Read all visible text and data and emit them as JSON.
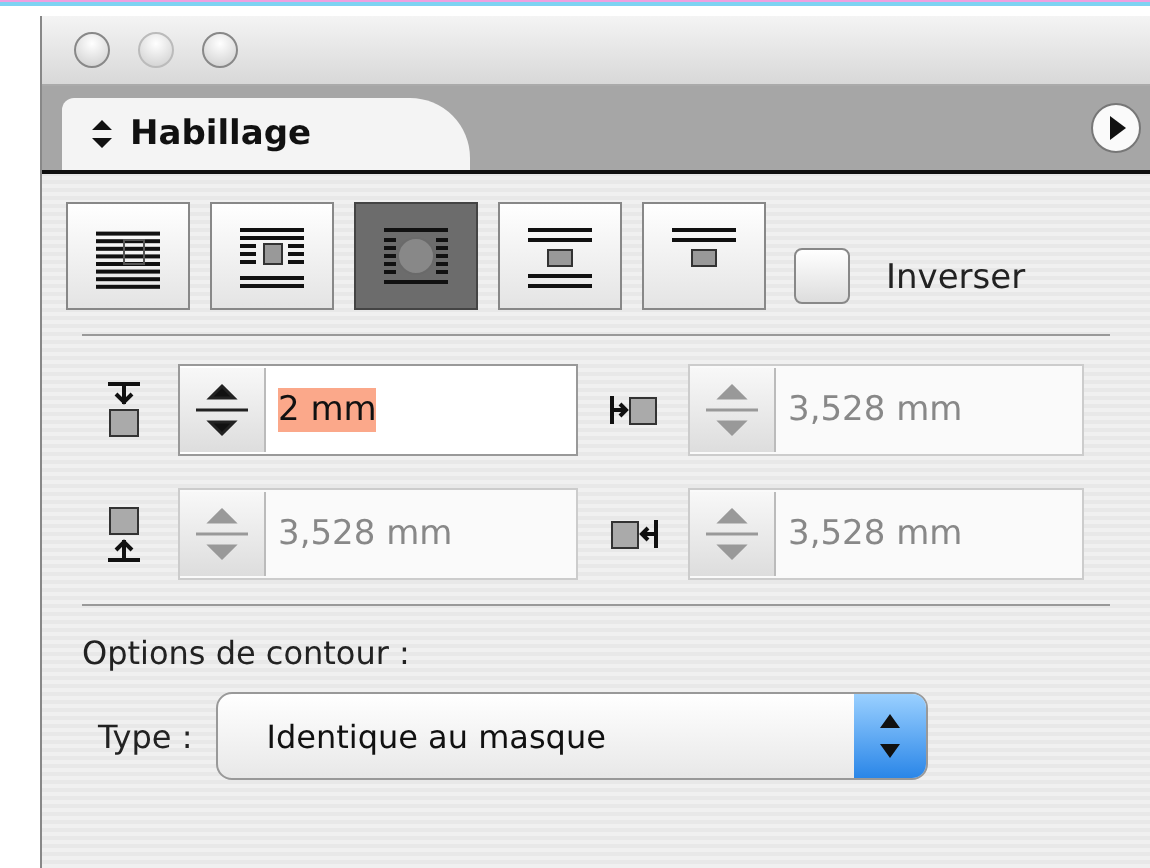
{
  "panel": {
    "tab": {
      "label": "Habillage",
      "selected": true
    }
  },
  "wrap_options": [
    {
      "kind": "none",
      "selected": false
    },
    {
      "kind": "bounding-box",
      "selected": false
    },
    {
      "kind": "object-shape",
      "selected": true
    },
    {
      "kind": "jump-object",
      "selected": false
    },
    {
      "kind": "jump-next-column",
      "selected": false
    }
  ],
  "invert": {
    "label": "Inverser",
    "checked": false
  },
  "offsets": [
    {
      "kind": "top",
      "value": "2 mm",
      "disabled": false,
      "selected": true
    },
    {
      "kind": "left",
      "value": "3,528 mm",
      "disabled": true,
      "selected": false
    },
    {
      "kind": "bottom",
      "value": "3,528 mm",
      "disabled": true,
      "selected": false
    },
    {
      "kind": "right",
      "value": "3,528 mm",
      "disabled": true,
      "selected": false
    }
  ],
  "contour_options": {
    "heading": "Options de contour :",
    "type_label": "Type :",
    "type_value": "Identique au masque"
  }
}
